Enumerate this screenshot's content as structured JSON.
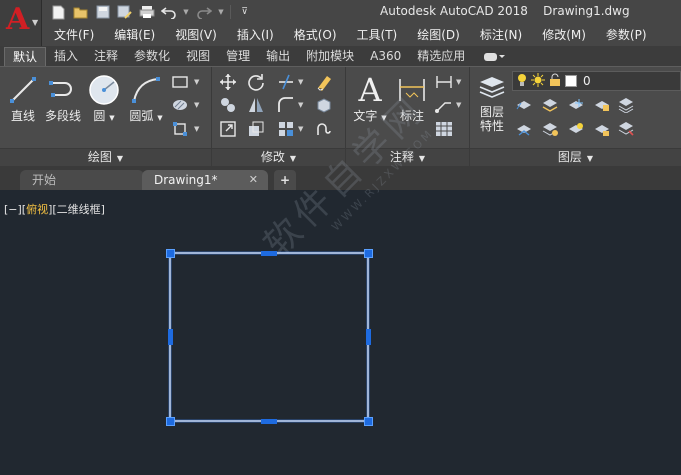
{
  "app": {
    "title": "Autodesk AutoCAD 2018    Drawing1.dwg",
    "logo_letter": "A"
  },
  "quick_access": [
    "new-icon",
    "open-icon",
    "save-icon",
    "saveas-icon",
    "print-icon",
    "undo-icon",
    "redo-icon",
    "customize-icon"
  ],
  "menu": [
    "文件(F)",
    "编辑(E)",
    "视图(V)",
    "插入(I)",
    "格式(O)",
    "工具(T)",
    "绘图(D)",
    "标注(N)",
    "修改(M)",
    "参数(P)"
  ],
  "ribbon_tabs": [
    "默认",
    "插入",
    "注释",
    "参数化",
    "视图",
    "管理",
    "输出",
    "附加模块",
    "A360",
    "精选应用"
  ],
  "ribbon": {
    "draw": {
      "line": "直线",
      "polyline": "多段线",
      "circle": "圆",
      "arc": "圆弧",
      "footer": "绘图"
    },
    "modify": {
      "footer": "修改"
    },
    "annotation": {
      "text": "文字",
      "dimension": "标注",
      "footer": "注释"
    },
    "layers": {
      "properties_line1": "图层",
      "properties_line2": "特性",
      "current_layer": "0",
      "footer": "图层"
    }
  },
  "file_tabs": {
    "start": "开始",
    "current": "Drawing1*",
    "close": "✕",
    "new": "+"
  },
  "viewport": {
    "control_prefix": "[−][",
    "view_name": "俯视",
    "control_suffix": "][二维线框]"
  },
  "watermark": {
    "main": "软件自学网",
    "sub": "WWW.RJZXW.COM"
  },
  "colors": {
    "accent_red": "#d21f24",
    "grip_blue": "#1e6be0",
    "highlight_yellow": "#f5c242",
    "canvas": "#212830"
  }
}
